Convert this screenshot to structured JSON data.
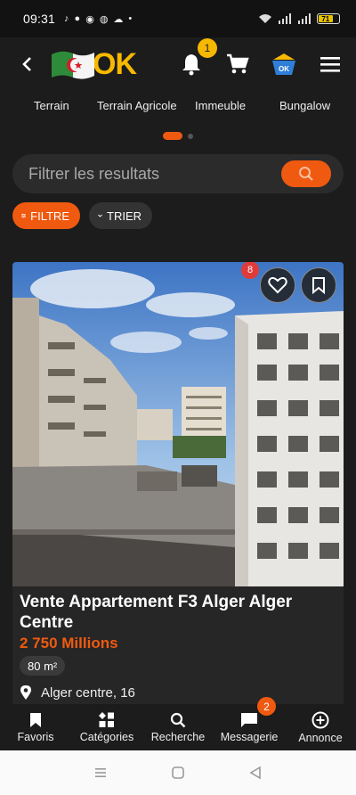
{
  "status_bar": {
    "time": "09:31",
    "battery": "71"
  },
  "header": {
    "logo_text": "OK",
    "notification_count": "1"
  },
  "categories": [
    "Terrain",
    "Terrain Agricole",
    "Immeuble",
    "Bungalow"
  ],
  "search": {
    "placeholder": "Filtrer les resultats"
  },
  "filters": {
    "filter_label": "FILTRE",
    "sort_label": "TRIER"
  },
  "listing": {
    "favorite_count": "8",
    "title": "Vente Appartement F3 Alger Alger Centre",
    "price": "2 750 Millions",
    "area": "80 m²",
    "location": "Alger centre, 16"
  },
  "bottom_nav": {
    "items": [
      {
        "label": "Favoris",
        "icon": "bookmark-icon"
      },
      {
        "label": "Catégories",
        "icon": "categories-icon"
      },
      {
        "label": "Recherche",
        "icon": "search-icon"
      },
      {
        "label": "Messagerie",
        "icon": "chat-icon",
        "badge": "2"
      },
      {
        "label": "Annonce",
        "icon": "add-circle-icon"
      }
    ]
  },
  "colors": {
    "accent": "#ef5a10",
    "brand_yellow": "#f6b800",
    "background": "#1c1c1c"
  }
}
